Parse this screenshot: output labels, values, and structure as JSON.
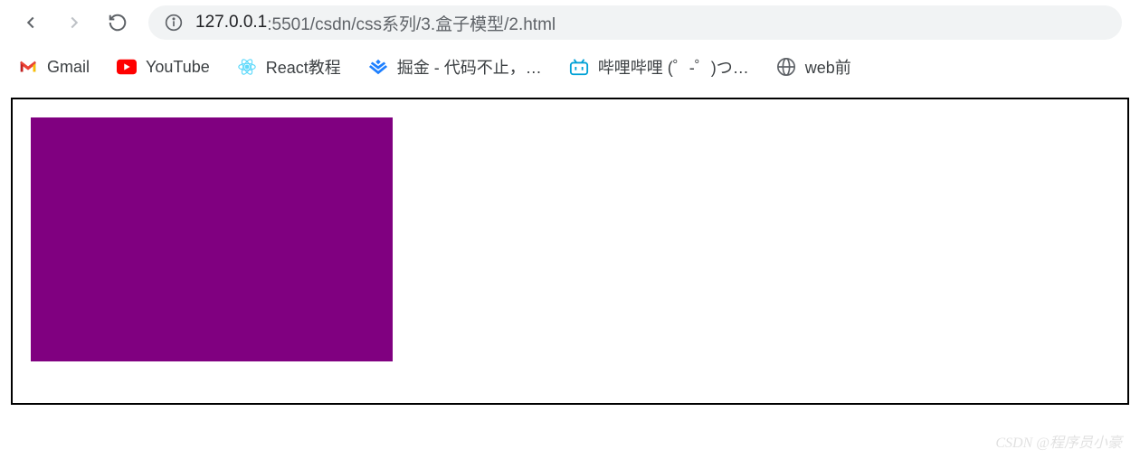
{
  "toolbar": {
    "url_host": "127.0.0.1",
    "url_rest": ":5501/csdn/css系列/3.盒子模型/2.html"
  },
  "bookmarks": {
    "gmail": "Gmail",
    "youtube": "YouTube",
    "react": "React教程",
    "juejin": "掘金 - 代码不止，…",
    "bilibili": "哔哩哔哩 (゜-゜)つ…",
    "web": "web前"
  },
  "watermark": "CSDN @程序员小豪"
}
